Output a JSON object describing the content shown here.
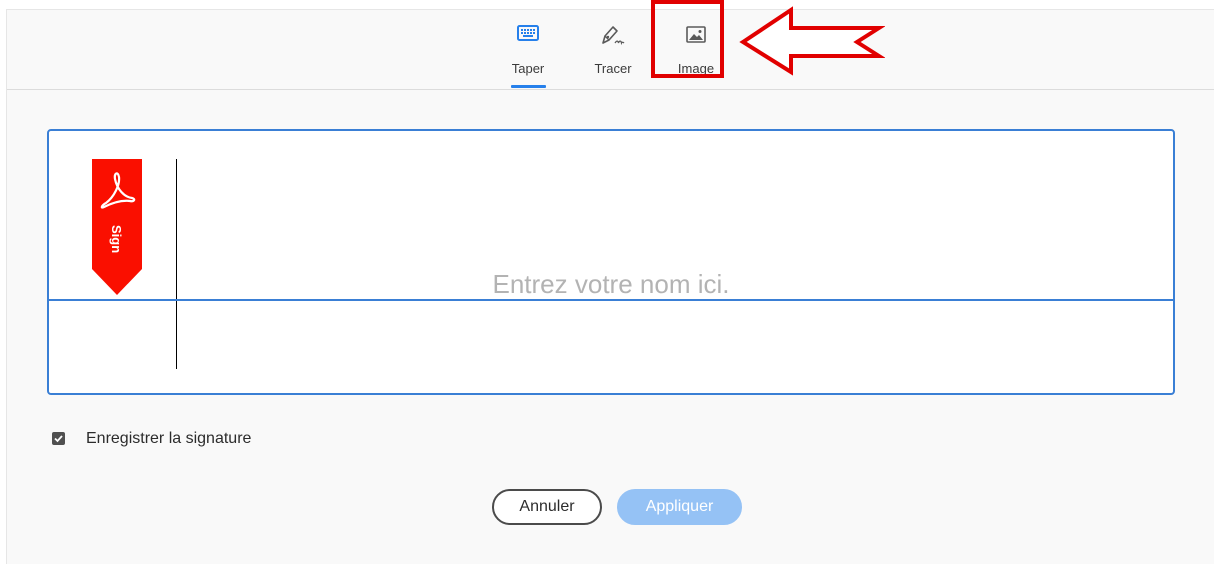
{
  "tabs": {
    "taper": {
      "label": "Taper",
      "icon": "keyboard-icon",
      "active": true
    },
    "tracer": {
      "label": "Tracer",
      "icon": "pen-draw-icon",
      "active": false
    },
    "image": {
      "label": "Image",
      "icon": "image-icon",
      "active": false
    }
  },
  "signature": {
    "placeholder": "Entrez votre nom ici.",
    "badge_text": "Sign",
    "badge_icon": "acrobat-logo-icon"
  },
  "save_signature": {
    "label": "Enregistrer la signature",
    "checked": true
  },
  "buttons": {
    "cancel": "Annuler",
    "apply": "Appliquer"
  },
  "colors": {
    "accent": "#2680eb",
    "apply_disabled": "#95c2f5",
    "annotation_red": "#e10000",
    "badge_red": "#fa0f00"
  }
}
